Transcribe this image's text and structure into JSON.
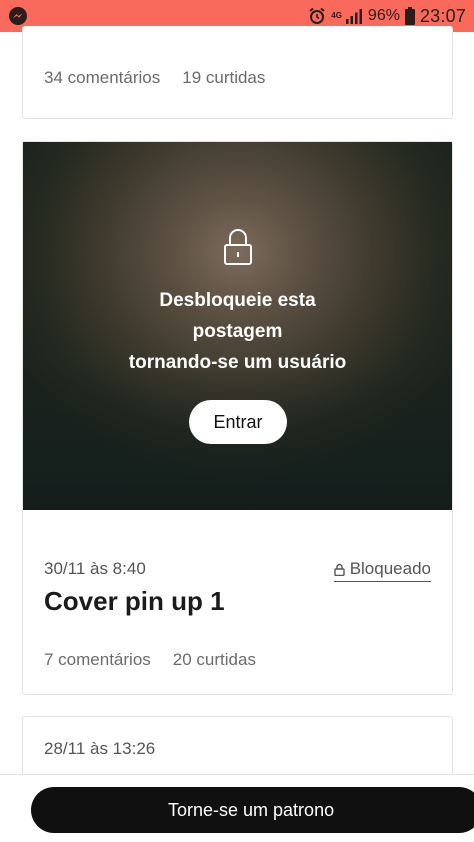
{
  "status_bar": {
    "network": "4G",
    "battery": "96%",
    "time": "23:07",
    "icons": [
      "messenger-icon",
      "alarm-icon",
      "signal-icon",
      "battery-icon"
    ]
  },
  "posts": [
    {
      "comments": "34 comentários",
      "likes": "19 curtidas"
    },
    {
      "unlock_line1": "Desbloqueie esta",
      "unlock_line2": "postagem",
      "unlock_line3": "tornando-se um usuário",
      "enter_label": "Entrar",
      "date": "30/11 às 8:40",
      "locked_label": "Bloqueado",
      "title": "Cover pin up 1",
      "comments": "7 comentários",
      "likes": "20 curtidas"
    },
    {
      "date": "28/11 às 13:26"
    }
  ],
  "cta": {
    "label": "Torne-se um patrono"
  },
  "colors": {
    "status_bar": "#f96a5c",
    "button_dark": "#101010"
  }
}
